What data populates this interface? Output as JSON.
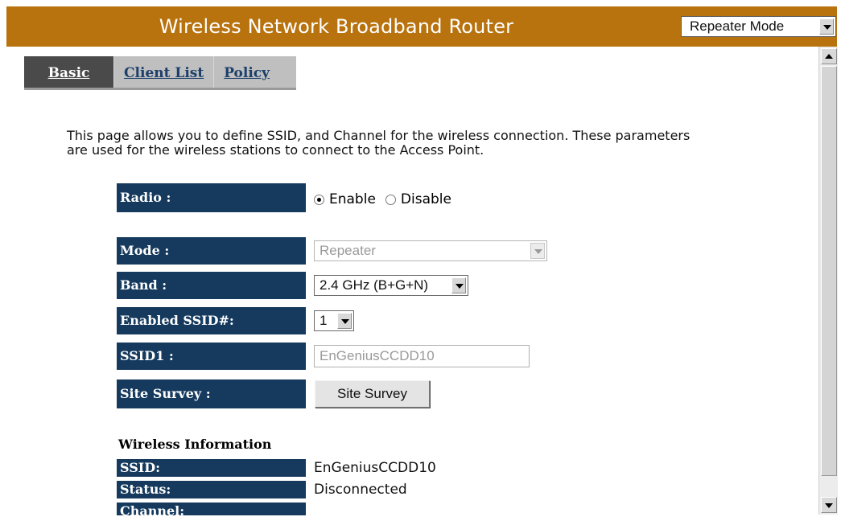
{
  "header": {
    "title": "Wireless Network Broadband Router",
    "mode_select": {
      "value": "Repeater Mode"
    }
  },
  "tabs": [
    {
      "label": "Basic",
      "active": true
    },
    {
      "label": "Client List",
      "active": false
    },
    {
      "label": "Policy",
      "active": false
    }
  ],
  "description": "This page allows you to define SSID, and Channel for the wireless connection. These parameters are used for the wireless stations to connect to the Access Point.",
  "form": {
    "radio": {
      "label": "Radio :",
      "enable_label": "Enable",
      "disable_label": "Disable",
      "selected": "Enable"
    },
    "mode": {
      "label": "Mode :",
      "value": "Repeater",
      "disabled": true
    },
    "band": {
      "label": "Band :",
      "value": "2.4 GHz (B+G+N)"
    },
    "enabled_ssid": {
      "label": "Enabled SSID#:",
      "value": "1"
    },
    "ssid1": {
      "label": "SSID1 :",
      "value": "EnGeniusCCDD10"
    },
    "site_survey": {
      "label": "Site Survey :",
      "button_label": "Site Survey"
    }
  },
  "wireless_info": {
    "title": "Wireless Information",
    "rows": [
      {
        "label": "SSID:",
        "value": "EnGeniusCCDD10"
      },
      {
        "label": "Status:",
        "value": "Disconnected"
      },
      {
        "label": "Channel:",
        "value": ""
      }
    ]
  },
  "colors": {
    "header_bg": "#b8720e",
    "label_bg": "#153a5e",
    "active_tab_bg": "#4a4a4a",
    "tab_bar_bg": "#bfbfbf"
  }
}
